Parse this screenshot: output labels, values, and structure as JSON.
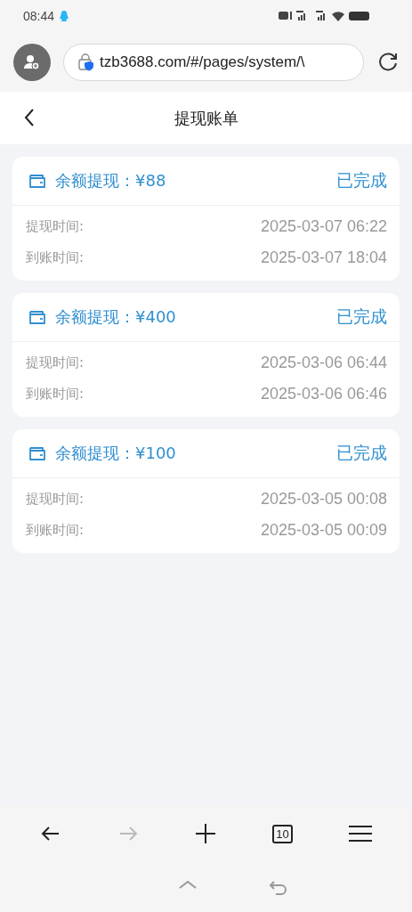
{
  "status_bar": {
    "time": "08:44"
  },
  "browser": {
    "url": "tzb3688.com/#/pages/system/\\"
  },
  "page": {
    "title": "提现账单"
  },
  "records": [
    {
      "title": "余额提现：¥88",
      "status": "已完成",
      "fields": [
        {
          "label": "提现时间:",
          "value": "2025-03-07 06:22"
        },
        {
          "label": "到账时间:",
          "value": "2025-03-07 18:04"
        }
      ]
    },
    {
      "title": "余额提现：¥400",
      "status": "已完成",
      "fields": [
        {
          "label": "提现时间:",
          "value": "2025-03-06 06:44"
        },
        {
          "label": "到账时间:",
          "value": "2025-03-06 06:46"
        }
      ]
    },
    {
      "title": "余额提现：¥100",
      "status": "已完成",
      "fields": [
        {
          "label": "提现时间:",
          "value": "2025-03-05 00:08"
        },
        {
          "label": "到账时间:",
          "value": "2025-03-05 00:09"
        }
      ]
    }
  ],
  "toolbar": {
    "back_disabled": false,
    "forward_disabled": true,
    "tab_count": "10"
  }
}
